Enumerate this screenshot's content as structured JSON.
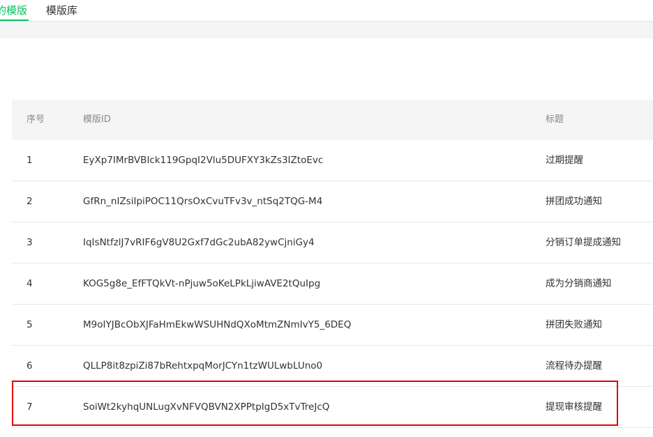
{
  "tabs": {
    "mine_label": "的模版",
    "library_label": "模版库"
  },
  "table": {
    "headers": {
      "index": "序号",
      "template_id": "模版ID",
      "title": "标题"
    },
    "rows": [
      {
        "index": "1",
        "template_id": "EyXp7IMrBVBIck119GpqI2Vlu5DUFXY3kZs3IZtoEvc",
        "title": "过期提醒"
      },
      {
        "index": "2",
        "template_id": "GfRn_nIZsiIpiPOC11QrsOxCvuTFv3v_ntSq2TQG-M4",
        "title": "拼团成功通知"
      },
      {
        "index": "3",
        "template_id": "IqIsNtfzlJ7vRIF6gV8U2Gxf7dGc2ubA82ywCjniGy4",
        "title": "分销订单提成通知"
      },
      {
        "index": "4",
        "template_id": "KOG5g8e_EfFTQkVt-nPjuw5oKeLPkLjiwAVE2tQuIpg",
        "title": "成为分销商通知"
      },
      {
        "index": "5",
        "template_id": "M9oIYJBcObXJFaHmEkwWSUHNdQXoMtmZNmIvY5_6DEQ",
        "title": "拼团失败通知"
      },
      {
        "index": "6",
        "template_id": "QLLP8it8zpiZi87bRehtxpqMorJCYn1tzWULwbLUno0",
        "title": "流程待办提醒"
      },
      {
        "index": "7",
        "template_id": "SoiWt2kyhqUNLugXvNFVQBVN2XPPtpIgD5xTvTreJcQ",
        "title": "提现审核提醒"
      }
    ]
  },
  "colors": {
    "accent": "#07c160",
    "highlight": "#e00000"
  }
}
